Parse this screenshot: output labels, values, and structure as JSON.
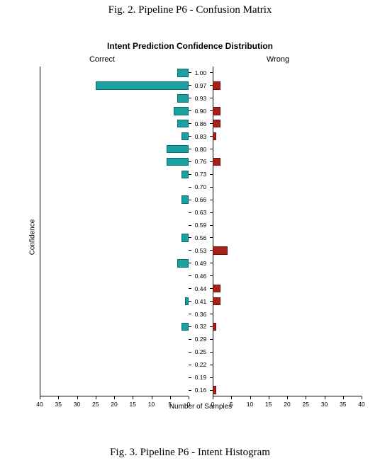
{
  "caption_top": "Fig. 2.   Pipeline P6 - Confusion Matrix",
  "caption_bottom": "Fig. 3.   Pipeline P6 - Intent Histogram",
  "chart_data": {
    "type": "bar",
    "title": "Intent Prediction Confidence Distribution",
    "xlabel": "Number of Samples",
    "ylabel": "Confidence",
    "facets": [
      {
        "name": "Correct",
        "direction": "left",
        "xlim": [
          0,
          40
        ],
        "color": "#1aa0a0"
      },
      {
        "name": "Wrong",
        "direction": "right",
        "xlim": [
          0,
          40
        ],
        "color": "#a8201a"
      }
    ],
    "x_ticks": [
      0,
      5,
      10,
      15,
      20,
      25,
      30,
      35,
      40
    ],
    "y_categories": [
      "1.00",
      "0.97",
      "0.93",
      "0.90",
      "0.86",
      "0.83",
      "0.80",
      "0.76",
      "0.73",
      "0.70",
      "0.66",
      "0.63",
      "0.59",
      "0.56",
      "0.53",
      "0.49",
      "0.46",
      "0.44",
      "0.41",
      "0.36",
      "0.32",
      "0.29",
      "0.25",
      "0.22",
      "0.19",
      "0.16"
    ],
    "series": [
      {
        "name": "Correct",
        "facet": "Correct",
        "values": {
          "1.00": 3,
          "0.97": 25,
          "0.93": 3,
          "0.90": 4,
          "0.86": 3,
          "0.83": 2,
          "0.80": 6,
          "0.76": 6,
          "0.73": 2,
          "0.70": 0,
          "0.66": 2,
          "0.63": 0,
          "0.59": 0,
          "0.56": 2,
          "0.53": 0,
          "0.49": 3,
          "0.46": 0,
          "0.44": 0,
          "0.41": 1,
          "0.36": 0,
          "0.32": 2,
          "0.29": 0,
          "0.25": 0,
          "0.22": 0,
          "0.19": 0,
          "0.16": 0
        }
      },
      {
        "name": "Wrong",
        "facet": "Wrong",
        "values": {
          "1.00": 0,
          "0.97": 2,
          "0.93": 0,
          "0.90": 2,
          "0.86": 2,
          "0.83": 1,
          "0.80": 0,
          "0.76": 2,
          "0.73": 0,
          "0.70": 0,
          "0.66": 0,
          "0.63": 0,
          "0.59": 0,
          "0.56": 0,
          "0.53": 4,
          "0.49": 0,
          "0.46": 0,
          "0.44": 2,
          "0.41": 2,
          "0.36": 0,
          "0.32": 1,
          "0.29": 0,
          "0.25": 0,
          "0.22": 0,
          "0.19": 0,
          "0.16": 1
        }
      }
    ]
  }
}
